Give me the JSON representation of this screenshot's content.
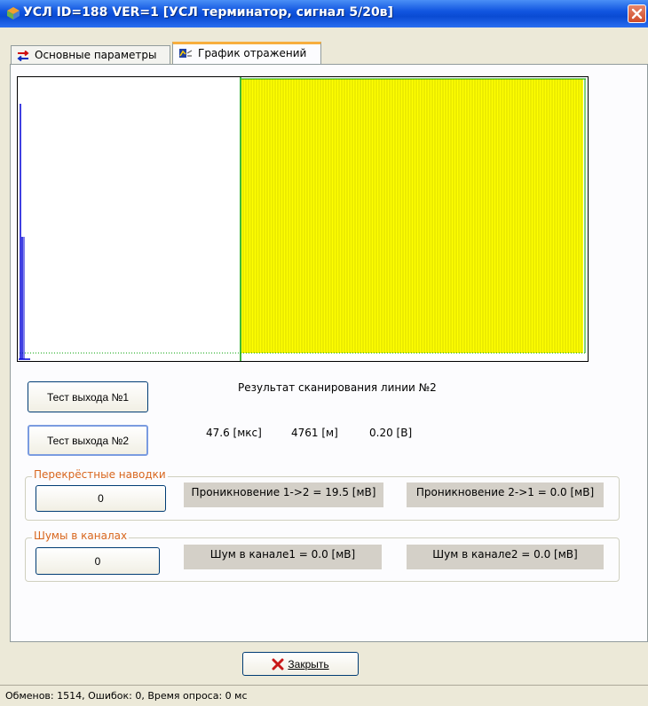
{
  "window": {
    "title": "УСЛ ID=188 VER=1 [УСЛ терминатор, сигнал 5/20в]"
  },
  "tabs": [
    {
      "label": "Основные параметры",
      "active": false
    },
    {
      "label": "График отражений",
      "active": true
    }
  ],
  "chart_data": {
    "type": "line",
    "title": "",
    "colors": {
      "signal": "#0000d8",
      "fill": "#ffff00",
      "grid": "#00a000"
    }
  },
  "tests": {
    "button1": "Тест выхода №1",
    "button2": "Тест выхода №2",
    "result_title": "Результат сканирования линии №2",
    "time": "47.6 [мкс]",
    "distance": "4761 [м]",
    "voltage": "0.20 [В]"
  },
  "crosstalk": {
    "title": "Перекрёстные наводки",
    "button": "0",
    "penetration_1_2": "Проникновение 1->2 =  19.5 [мВ]",
    "penetration_2_1": "Проникновение 2->1 =  0.0 [мВ]"
  },
  "noise": {
    "title": "Шумы в каналах",
    "button": "0",
    "channel1": "Шум в канале1 =  0.0 [мВ]",
    "channel2": "Шум в канале2 =  0.0 [мВ]"
  },
  "footer": {
    "close_label": "Закрыть"
  },
  "status": {
    "text": "Обменов: 1514, Ошибок: 0, Время опроса: 0 мс"
  }
}
